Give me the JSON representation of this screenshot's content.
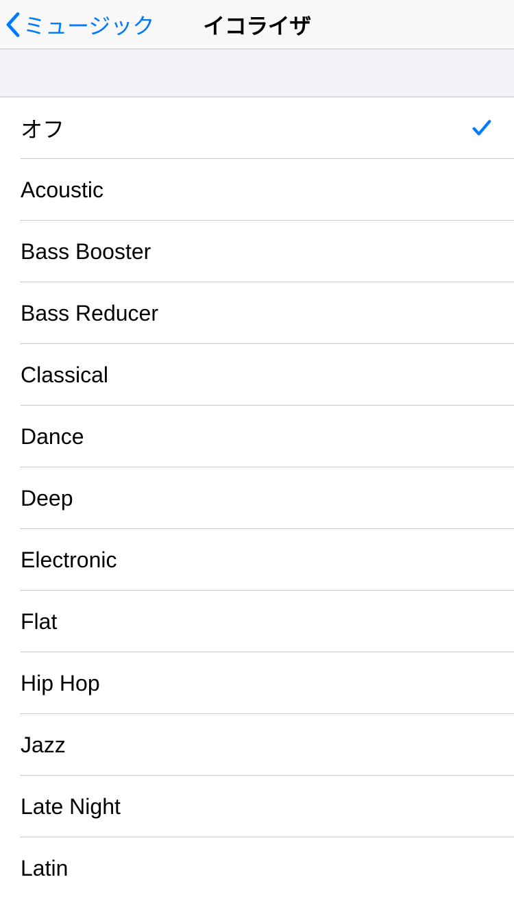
{
  "nav": {
    "back_label": "ミュージック",
    "title": "イコライザ"
  },
  "equalizer": {
    "selected_index": 0,
    "options": [
      {
        "label": "オフ"
      },
      {
        "label": "Acoustic"
      },
      {
        "label": "Bass Booster"
      },
      {
        "label": "Bass Reducer"
      },
      {
        "label": "Classical"
      },
      {
        "label": "Dance"
      },
      {
        "label": "Deep"
      },
      {
        "label": "Electronic"
      },
      {
        "label": "Flat"
      },
      {
        "label": "Hip Hop"
      },
      {
        "label": "Jazz"
      },
      {
        "label": "Late Night"
      },
      {
        "label": "Latin"
      }
    ]
  }
}
